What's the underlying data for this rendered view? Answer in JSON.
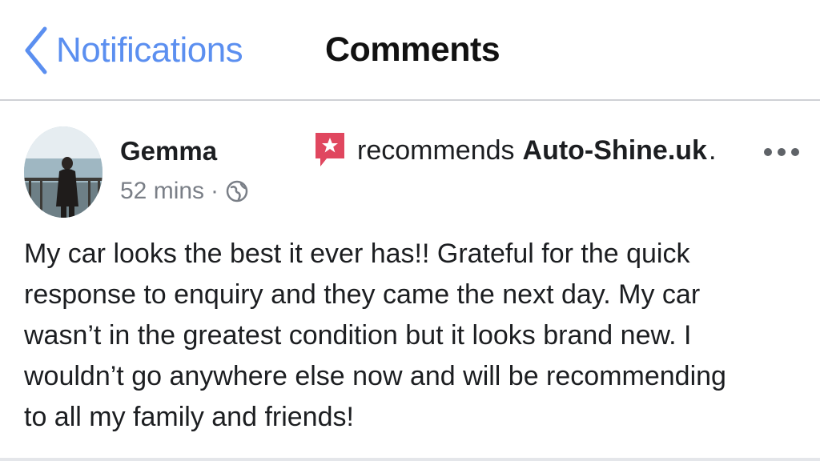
{
  "header": {
    "back_label": "Notifications",
    "title": "Comments"
  },
  "post": {
    "author": "Gemma",
    "time": "52 mins",
    "separator": "·",
    "privacy_icon": "globe-icon",
    "recommends_text": "recommends",
    "page_name": "Auto-Shine.uk",
    "period": ".",
    "body_lines": [
      "My car looks the best it ever has!! Grateful for the quick",
      "response to enquiry and they came the next day. My car",
      "wasn’t in the greatest condition but it looks brand new. I",
      "wouldn’t go anywhere else now and will be recommending",
      "to all my family and friends!"
    ]
  },
  "colors": {
    "accent": "#5b8ff0",
    "recommend_icon": "#e0475f",
    "text": "#1c1e21",
    "muted": "#7a7f87"
  }
}
